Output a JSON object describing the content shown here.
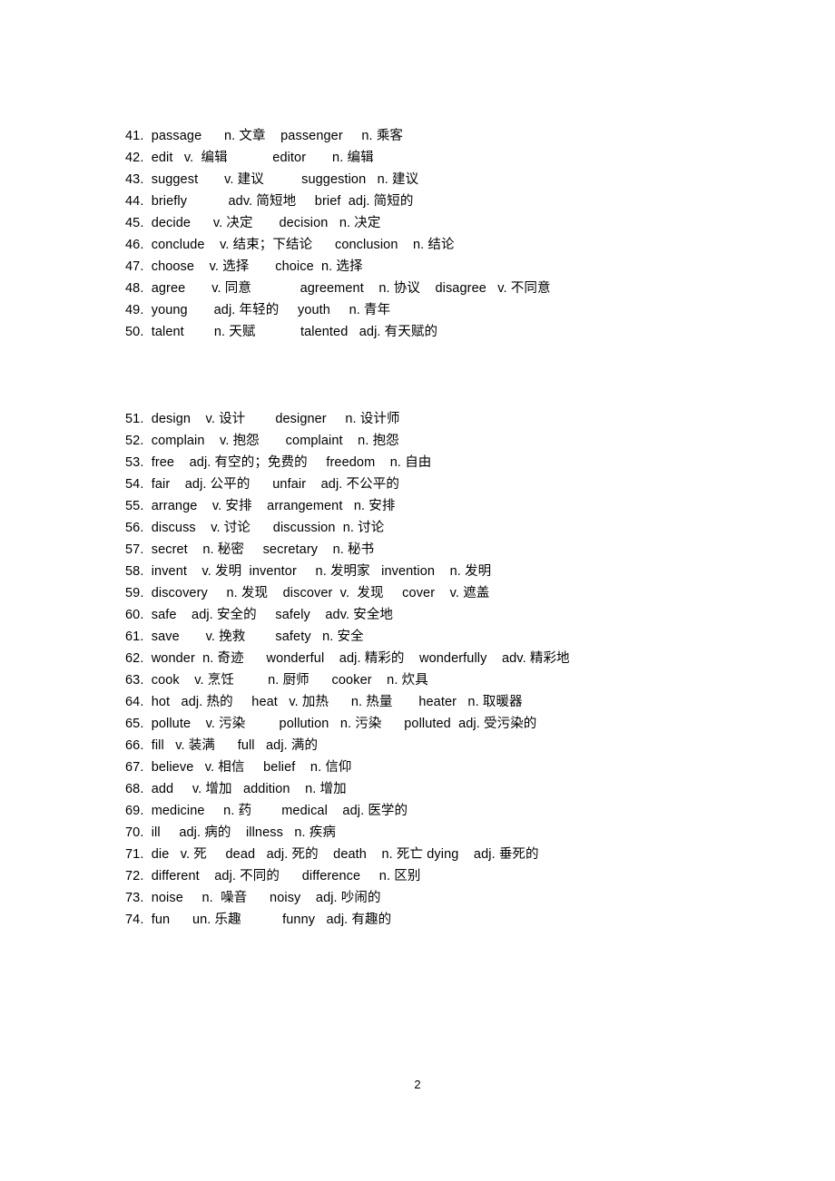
{
  "document": {
    "page_number": "2",
    "background_color": "#ffffff",
    "text_color": "#000000"
  },
  "blocks": [
    {
      "id": "block-1",
      "rows": [
        "41.  passage      n. 文章    passenger     n. 乘客",
        "42.  edit   v.  编辑            editor       n. 编辑",
        "43.  suggest       v. 建议          suggestion   n. 建议",
        "44.  briefly           adv. 简短地     brief  adj. 简短的",
        "45.  decide      v. 决定       decision   n. 决定",
        "46.  conclude    v. 结束；下结论      conclusion    n. 结论",
        "47.  choose    v. 选择       choice  n. 选择",
        "48.  agree       v. 同意             agreement    n. 协议    disagree   v. 不同意",
        "49.  young       adj. 年轻的     youth     n. 青年",
        "50.  talent        n. 天赋            talented   adj. 有天赋的"
      ]
    },
    {
      "id": "block-2",
      "rows": [
        "51.  design    v. 设计        designer     n. 设计师",
        "52.  complain    v. 抱怨       complaint    n. 抱怨",
        "53.  free    adj. 有空的；免费的     freedom    n. 自由",
        "54.  fair    adj. 公平的      unfair    adj. 不公平的",
        "55.  arrange    v. 安排    arrangement   n. 安排",
        "56.  discuss    v. 讨论      discussion  n. 讨论",
        "57.  secret    n. 秘密     secretary    n. 秘书",
        "58.  invent    v. 发明  inventor     n. 发明家   invention    n. 发明",
        "59.  discovery     n. 发现    discover  v.  发现     cover    v. 遮盖",
        "60.  safe    adj. 安全的     safely    adv. 安全地",
        "61.  save       v. 挽救        safety   n. 安全",
        "62.  wonder  n. 奇迹      wonderful    adj. 精彩的    wonderfully    adv. 精彩地",
        "63.  cook    v. 烹饪         n. 厨师      cooker    n. 炊具",
        "64.  hot   adj. 热的     heat   v. 加热      n. 热量       heater   n. 取暖器",
        "65.  pollute    v. 污染         pollution   n. 污染      polluted  adj. 受污染的",
        "66.  fill   v. 装满      full   adj. 满的",
        "67.  believe   v. 相信     belief    n. 信仰",
        "68.  add     v. 增加   addition    n. 增加",
        "69.  medicine     n. 药        medical    adj. 医学的",
        "70.  ill     adj. 病的    illness   n. 疾病",
        "71.  die   v. 死     dead   adj. 死的    death    n. 死亡 dying    adj. 垂死的",
        "72.  different    adj. 不同的      difference     n. 区别",
        "73.  noise     n.  噪音      noisy    adj. 吵闹的",
        "74.  fun      un. 乐趣           funny   adj. 有趣的"
      ]
    }
  ]
}
